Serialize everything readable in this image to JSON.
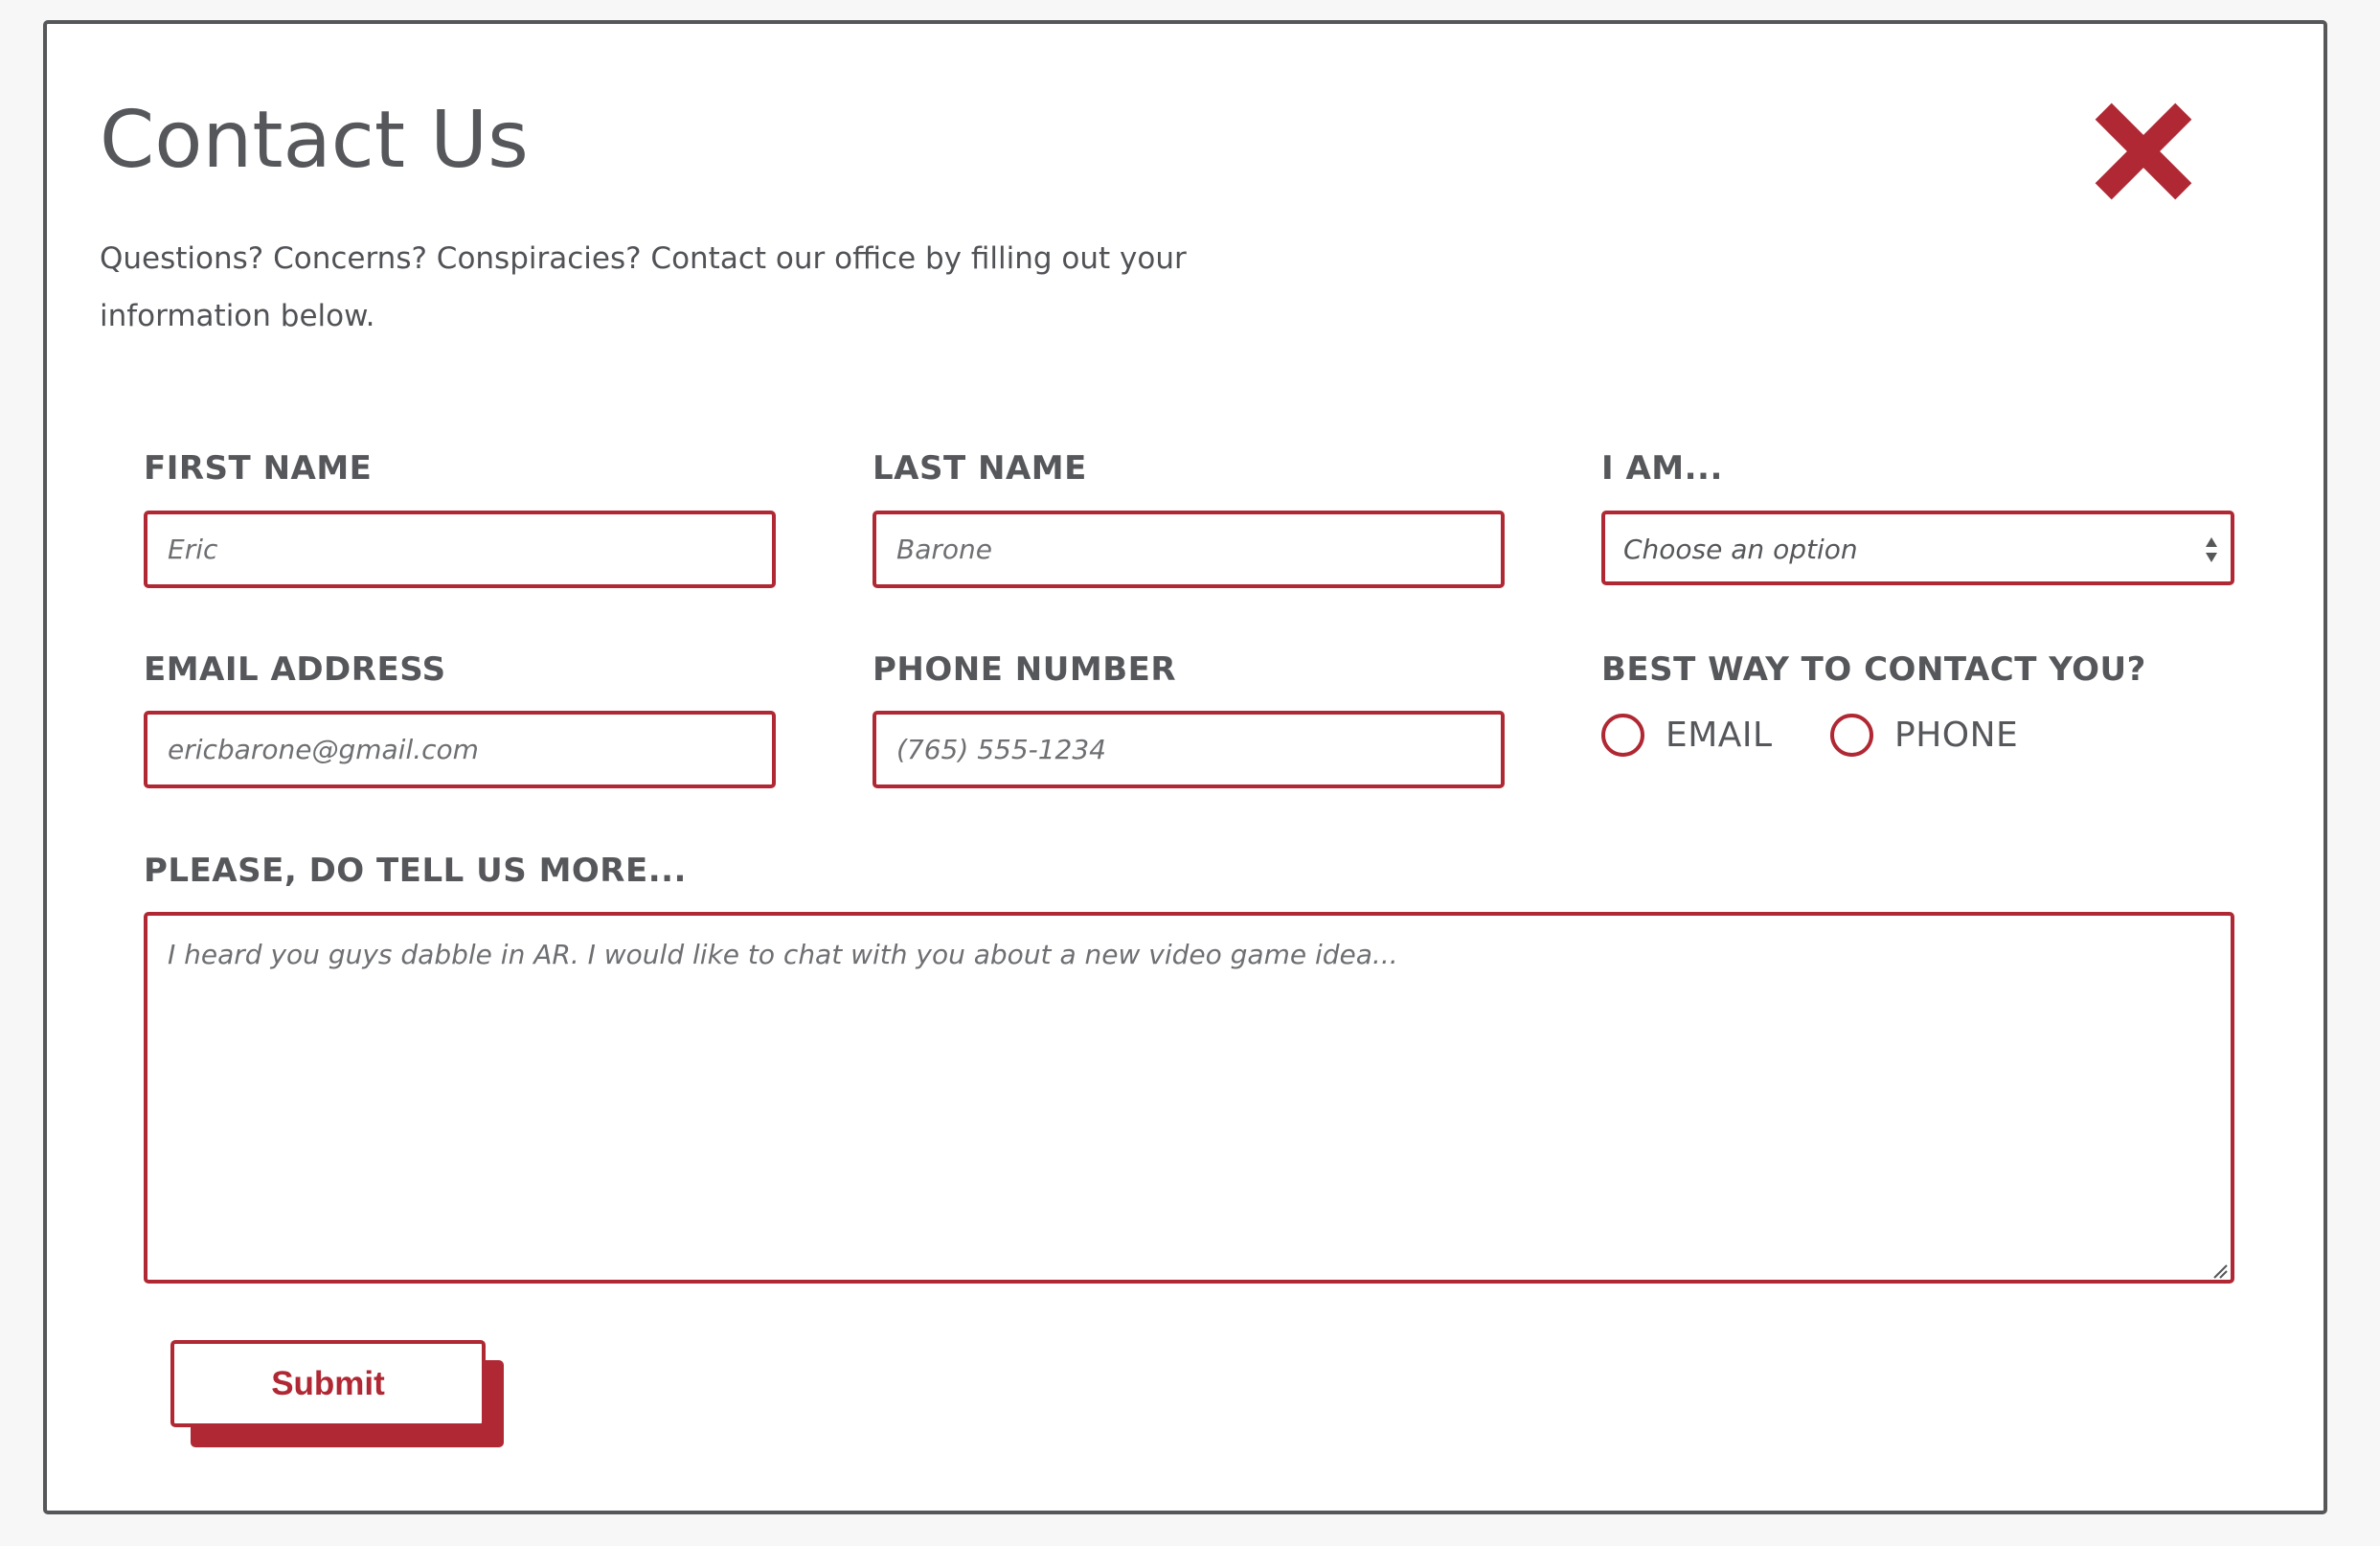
{
  "header": {
    "title": "Contact Us",
    "intro": "Questions? Concerns? Conspiracies? Contact our office by filling out your information below.",
    "close_icon": "close-x-icon"
  },
  "form": {
    "first_name": {
      "label": "FIRST NAME",
      "placeholder": "Eric"
    },
    "last_name": {
      "label": "LAST NAME",
      "placeholder": "Barone"
    },
    "i_am": {
      "label": "I AM...",
      "selected": "Choose an option"
    },
    "email": {
      "label": "EMAIL ADDRESS",
      "placeholder": "ericbarone@gmail.com"
    },
    "phone": {
      "label": "PHONE NUMBER",
      "placeholder": "(765) 555-1234"
    },
    "contact_method": {
      "label": "BEST WAY TO CONTACT YOU?",
      "options": [
        "EMAIL",
        "PHONE"
      ]
    },
    "message": {
      "label": "PLEASE, DO TELL US MORE...",
      "placeholder": "I heard you guys dabble in AR. I would like to chat with you about a new video game idea..."
    },
    "submit_label": "Submit"
  },
  "colors": {
    "accent": "#b02833",
    "border": "#555759",
    "text": "#55575b"
  }
}
